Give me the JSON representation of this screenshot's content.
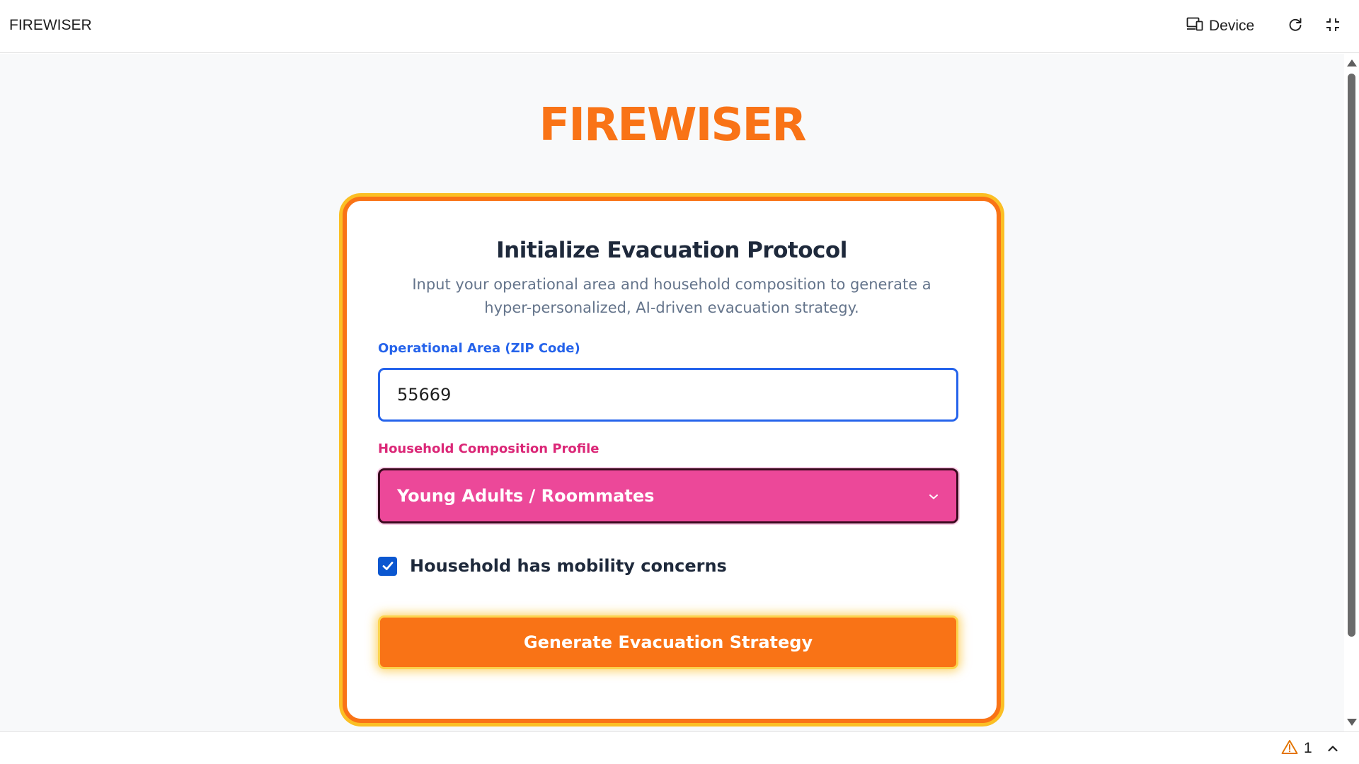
{
  "toolbar": {
    "app_title": "FIREWISER",
    "device_label": "Device",
    "device_icon": "devices-icon",
    "refresh_icon": "refresh-icon",
    "shrink_icon": "shrink-icon"
  },
  "page": {
    "brand": "FIREWISER",
    "card": {
      "title": "Initialize Evacuation Protocol",
      "subtitle": "Input your operational area and household composition to generate a hyper-personalized, AI-driven evacuation strategy.",
      "zip_label": "Operational Area (ZIP Code)",
      "zip_value": "55669",
      "household_label": "Household Composition Profile",
      "household_value": "Young Adults / Roommates",
      "mobility_label": "Household has mobility concerns",
      "mobility_checked": true,
      "generate_label": "Generate Evacuation Strategy"
    }
  },
  "statusbar": {
    "warning_count": "1",
    "warning_icon": "warning-icon",
    "collapse_icon": "chevron-up-icon"
  },
  "colors": {
    "accent_orange": "#f97316",
    "border_yellow": "#fbbf24",
    "zip_blue": "#2563eb",
    "select_pink": "#ec4899",
    "label_pink": "#db2777",
    "checkbox_blue": "#0b57d0",
    "warning_orange": "#e37400"
  }
}
